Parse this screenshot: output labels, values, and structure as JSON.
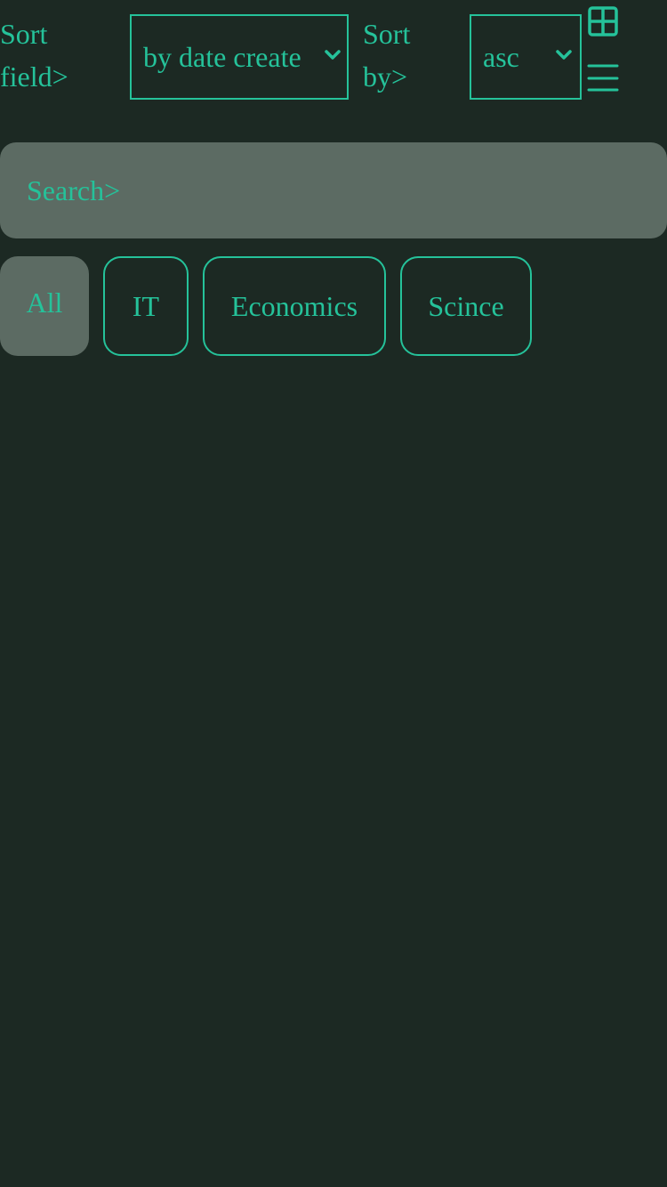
{
  "toolbar": {
    "sort_field_label_line1": "Sort",
    "sort_field_label_line2": "field>",
    "sort_field_value": "by date create",
    "sort_by_label_line1": "Sort",
    "sort_by_label_line2": "by>",
    "sort_order_value": "asc",
    "icons": [
      "grid-view-icon",
      "list-view-icon",
      "chevron-down-icon"
    ]
  },
  "search": {
    "placeholder": "Search>"
  },
  "categories": [
    {
      "label": "All",
      "active": true
    },
    {
      "label": "IT",
      "active": false
    },
    {
      "label": "Economics",
      "active": false
    },
    {
      "label": "Scince",
      "active": false
    }
  ],
  "colors": {
    "background": "#1c2923",
    "accent": "#25c29a",
    "surface": "#5c6b63"
  }
}
